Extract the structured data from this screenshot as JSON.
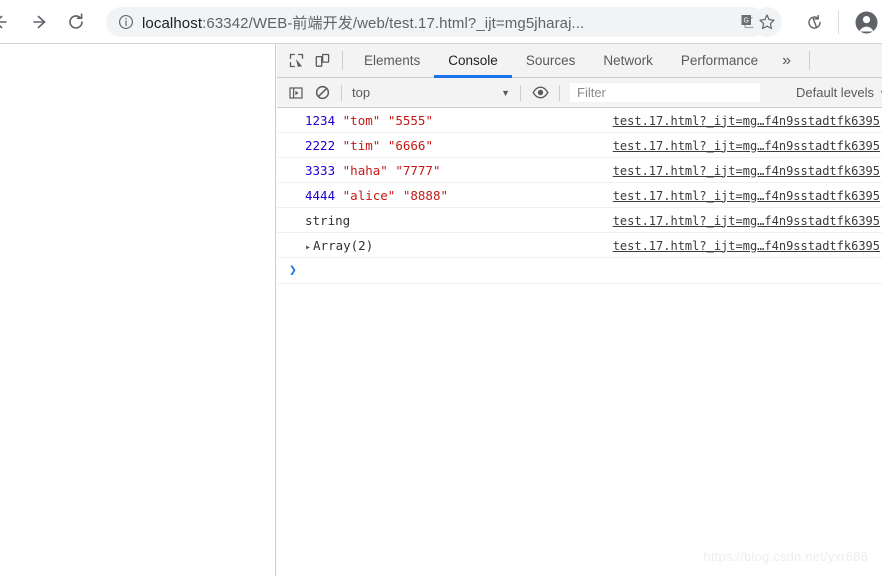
{
  "browser": {
    "back_icon": "arrow-left-icon",
    "forward_icon": "arrow-right-icon",
    "reload_icon": "reload-icon",
    "info_icon": "page-info-icon",
    "url_host": "localhost",
    "url_rest": ":63342/WEB-前端开发/web/test.17.html?_ijt=mg5jharaj...",
    "translate_icon": "translate-icon",
    "bookmark_icon": "star-icon",
    "sync_icon": "sync-icon",
    "avatar_icon": "profile-avatar-icon"
  },
  "devtools": {
    "inspect_icon": "inspect-element-icon",
    "device_toggle_icon": "device-toolbar-icon",
    "tabs": [
      {
        "label": "Elements",
        "active": false
      },
      {
        "label": "Console",
        "active": true
      },
      {
        "label": "Sources",
        "active": false
      },
      {
        "label": "Network",
        "active": false
      },
      {
        "label": "Performance",
        "active": false
      }
    ],
    "more_tabs_label": "»",
    "console_toolbar": {
      "sidebar_toggle_icon": "console-sidebar-icon",
      "clear_icon": "clear-console-icon",
      "context_value": "top",
      "context_caret": "▼",
      "eye_icon": "live-expression-eye-icon",
      "filter_placeholder": "Filter",
      "filter_value": "",
      "levels_label": "Default levels",
      "levels_caret": "▼"
    },
    "logs": [
      {
        "tokens": [
          {
            "text": "1234",
            "type": "num"
          },
          {
            "text": " ",
            "type": "plain"
          },
          {
            "text": "\"tom\"",
            "type": "str"
          },
          {
            "text": " ",
            "type": "plain"
          },
          {
            "text": "\"5555\"",
            "type": "str"
          }
        ],
        "source": "test.17.html?_ijt=mg…f4n9sstadtfk6395",
        "expandable": false
      },
      {
        "tokens": [
          {
            "text": "2222",
            "type": "num"
          },
          {
            "text": " ",
            "type": "plain"
          },
          {
            "text": "\"tim\"",
            "type": "str"
          },
          {
            "text": " ",
            "type": "plain"
          },
          {
            "text": "\"6666\"",
            "type": "str"
          }
        ],
        "source": "test.17.html?_ijt=mg…f4n9sstadtfk6395",
        "expandable": false
      },
      {
        "tokens": [
          {
            "text": "3333",
            "type": "num"
          },
          {
            "text": " ",
            "type": "plain"
          },
          {
            "text": "\"haha\"",
            "type": "str"
          },
          {
            "text": " ",
            "type": "plain"
          },
          {
            "text": "\"7777\"",
            "type": "str"
          }
        ],
        "source": "test.17.html?_ijt=mg…f4n9sstadtfk6395",
        "expandable": false
      },
      {
        "tokens": [
          {
            "text": "4444",
            "type": "num"
          },
          {
            "text": " ",
            "type": "plain"
          },
          {
            "text": "\"alice\"",
            "type": "str"
          },
          {
            "text": " ",
            "type": "plain"
          },
          {
            "text": "\"8888\"",
            "type": "str"
          }
        ],
        "source": "test.17.html?_ijt=mg…f4n9sstadtfk6395",
        "expandable": false
      },
      {
        "tokens": [
          {
            "text": "string",
            "type": "plain"
          }
        ],
        "source": "test.17.html?_ijt=mg…f4n9sstadtfk6395",
        "expandable": false
      },
      {
        "tokens": [
          {
            "text": "Array(2)",
            "type": "plain"
          }
        ],
        "source": "test.17.html?_ijt=mg…f4n9sstadtfk6395",
        "expandable": true,
        "disclosure": "▸"
      }
    ],
    "prompt_arrow": "❯"
  },
  "watermark": "https://blog.csdn.net/yxr686",
  "colors": {
    "accent": "#1a73e8",
    "number": "#1c00cf",
    "string": "#c41a16",
    "toolbar_bg": "#f3f3f3",
    "omnibox_bg": "#f1f3f4"
  }
}
